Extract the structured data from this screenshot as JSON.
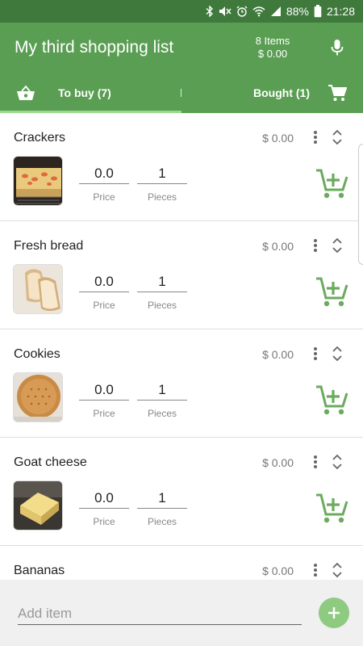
{
  "status": {
    "battery_pct": "88%",
    "time": "21:28"
  },
  "header": {
    "title": "My third shopping list",
    "items_count": "8 Items",
    "total": "$ 0.00"
  },
  "tabs": [
    {
      "label": "To buy (7)",
      "selected": true
    },
    {
      "label": "Bought (1)",
      "selected": false
    }
  ],
  "labels": {
    "price": "Price",
    "pieces": "Pieces"
  },
  "items": [
    {
      "name": "Crackers",
      "total": "$ 0.00",
      "price": "0.0",
      "pieces": "1",
      "thumb": "crackers"
    },
    {
      "name": "Fresh bread",
      "total": "$ 0.00",
      "price": "0.0",
      "pieces": "1",
      "thumb": "bread"
    },
    {
      "name": "Cookies",
      "total": "$ 0.00",
      "price": "0.0",
      "pieces": "1",
      "thumb": "cookie"
    },
    {
      "name": "Goat cheese",
      "total": "$ 0.00",
      "price": "0.0",
      "pieces": "1",
      "thumb": "cheese"
    },
    {
      "name": "Bananas",
      "total": "$ 0.00"
    }
  ],
  "add_item": {
    "placeholder": "Add item"
  },
  "colors": {
    "status_bar": "#3f7a3c",
    "primary": "#5a9e53",
    "accent": "#6aab5e",
    "tab_indicator": "#9bd88f",
    "fab": "#8fca81"
  }
}
